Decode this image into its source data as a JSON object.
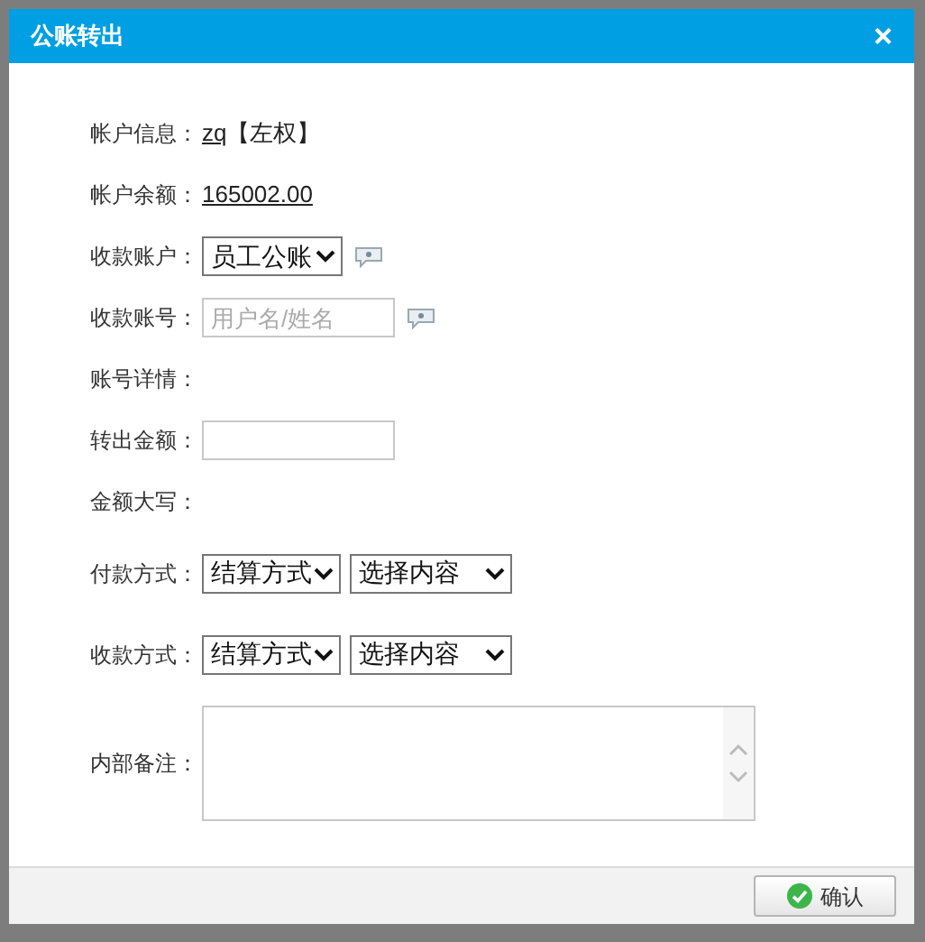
{
  "dialog": {
    "title": "公账转出",
    "close": "×"
  },
  "rows": [
    {
      "kind": "link",
      "label": "帐户信息：",
      "value": "zq",
      "suffix": "【左权】"
    },
    {
      "kind": "link",
      "label": "帐户余额：",
      "value": "165002.00"
    },
    {
      "kind": "select",
      "label": "收款账户：",
      "value": "员工公账",
      "help": true
    },
    {
      "kind": "input",
      "label": "收款账号：",
      "placeholder": "用户名/姓名",
      "help": true
    },
    {
      "kind": "text",
      "label": "账号详情："
    },
    {
      "kind": "input",
      "label": "转出金额："
    },
    {
      "kind": "text",
      "label": "金额大写："
    },
    {
      "kind": "selects",
      "label": "付款方式：",
      "values": [
        "结算方式",
        "选择内容"
      ]
    },
    {
      "kind": "selects",
      "label": "收款方式：",
      "values": [
        "结算方式",
        "选择内容"
      ]
    },
    {
      "kind": "textarea",
      "label": "内部备注："
    }
  ],
  "footer": {
    "confirm": "确认"
  }
}
